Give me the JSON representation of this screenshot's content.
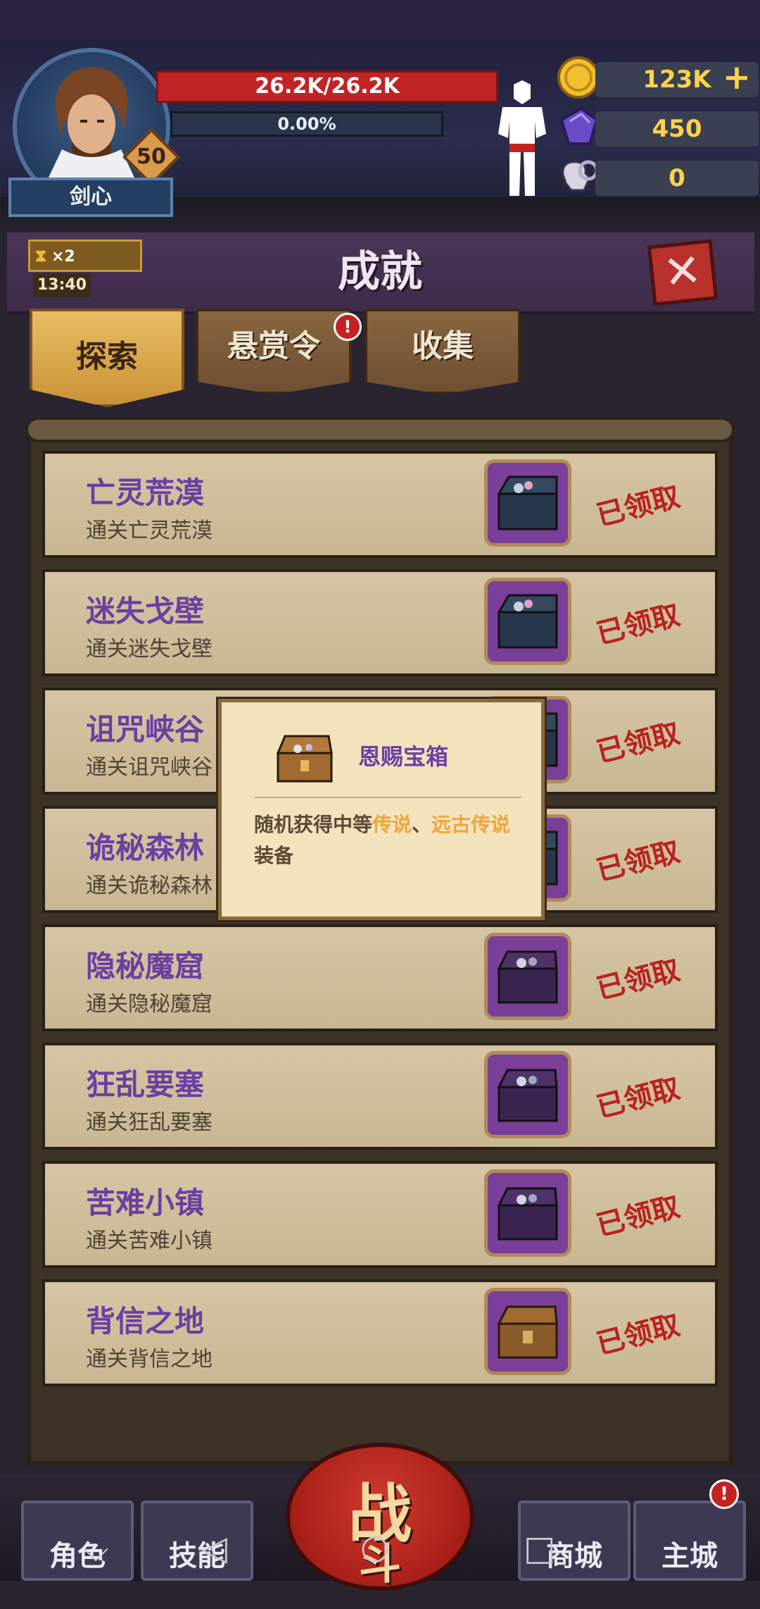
{
  "player": {
    "name": "剑心",
    "level": "50",
    "hp_text": "26.2K/26.2K",
    "xp_text": "0.00%"
  },
  "resources": {
    "gold": "123K",
    "gems": "450",
    "horns": "0"
  },
  "buff": {
    "multiplier": "×2",
    "time": "13:40"
  },
  "panel": {
    "title": "成就",
    "close_label": "✕"
  },
  "tabs": [
    {
      "label": "探索",
      "active": true
    },
    {
      "label": "悬赏令",
      "active": false,
      "badge": "!"
    },
    {
      "label": "收集",
      "active": false
    }
  ],
  "achievements": [
    {
      "title": "亡灵荒漠",
      "subtitle": "通关亡灵荒漠",
      "status": "已领取",
      "chest": "dark-blue-chest"
    },
    {
      "title": "迷失戈壁",
      "subtitle": "通关迷失戈壁",
      "status": "已领取",
      "chest": "dark-blue-chest"
    },
    {
      "title": "诅咒峡谷",
      "subtitle": "通关诅咒峡谷",
      "status": "已领取",
      "chest": "dark-blue-chest"
    },
    {
      "title": "诡秘森林",
      "subtitle": "通关诡秘森林",
      "status": "已领取",
      "chest": "dark-blue-chest"
    },
    {
      "title": "隐秘魔窟",
      "subtitle": "通关隐秘魔窟",
      "status": "已领取",
      "chest": "purple-chest"
    },
    {
      "title": "狂乱要塞",
      "subtitle": "通关狂乱要塞",
      "status": "已领取",
      "chest": "purple-chest"
    },
    {
      "title": "苦难小镇",
      "subtitle": "通关苦难小镇",
      "status": "已领取",
      "chest": "purple-chest"
    },
    {
      "title": "背信之地",
      "subtitle": "通关背信之地",
      "status": "已领取",
      "chest": "wooden-chest"
    }
  ],
  "tooltip": {
    "name": "恩赐宝箱",
    "desc_prefix": "随机获得中等",
    "desc_hl1": "传说",
    "desc_sep": "、",
    "desc_hl2": "远古传说",
    "desc_suffix": "装备"
  },
  "nav": {
    "character": "角色",
    "skills": "技能",
    "battle_top": "战",
    "battle_bottom": "斗",
    "shop": "商城",
    "city": "主城",
    "city_badge": "!"
  },
  "colors": {
    "accent_purple": "#6b3fa2",
    "claimed_red": "#b8221f",
    "highlight_orange": "#f0a53a",
    "gold": "#ffd24a"
  }
}
